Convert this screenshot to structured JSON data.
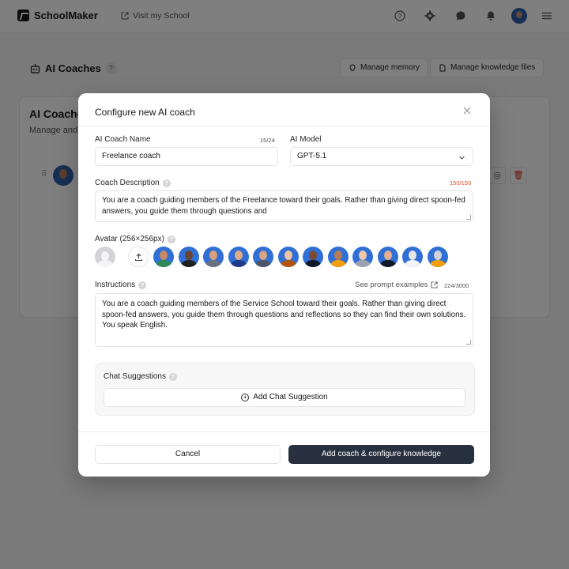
{
  "app": {
    "brand": "SchoolMaker",
    "visit_label": "Visit my School"
  },
  "page": {
    "title": "AI Coaches",
    "help": "?",
    "manage_memory": "Manage memory",
    "manage_knowledge": "Manage knowledge files",
    "card_title": "AI Coaches",
    "card_subtitle": "Manage and"
  },
  "modal": {
    "title": "Configure new AI coach",
    "close": "✕",
    "name": {
      "label": "AI Coach Name",
      "value": "Freelance coach",
      "counter": "15/24"
    },
    "model": {
      "label": "AI Model",
      "value": "GPT-5.1"
    },
    "description": {
      "label": "Coach Description",
      "counter": "150/150",
      "value": "You are a coach guiding members of the Freelance toward their goals. Rather than giving direct spoon-fed answers, you guide them through questions and"
    },
    "avatar": {
      "label": "Avatar (256×256px)",
      "options": [
        {
          "skin": "#c98b62",
          "cloth": "#2e8b57",
          "bg": "#2f6fd6"
        },
        {
          "skin": "#6b4330",
          "cloth": "#1f1f1f",
          "bg": "#2f6fd6"
        },
        {
          "skin": "#d9a07a",
          "cloth": "#6b7280",
          "bg": "#2f6fd6"
        },
        {
          "skin": "#e0ac85",
          "cloth": "#1e3a8a",
          "bg": "#2f6fd6"
        },
        {
          "skin": "#d7a584",
          "cloth": "#4b5563",
          "bg": "#2f6fd6"
        },
        {
          "skin": "#f0c3a0",
          "cloth": "#b45309",
          "bg": "#2f6fd6"
        },
        {
          "skin": "#7a4a33",
          "cloth": "#111827",
          "bg": "#2f6fd6"
        },
        {
          "skin": "#b87a55",
          "cloth": "#f59e0b",
          "bg": "#2f6fd6"
        },
        {
          "skin": "#f2c9a6",
          "cloth": "#9ca3af",
          "bg": "#2f6fd6"
        },
        {
          "skin": "#e3b08c",
          "cloth": "#111827",
          "bg": "#2f6fd6"
        },
        {
          "skin": "#e5e7eb",
          "cloth": "#f3f4f6",
          "bg": "#2f6fd6"
        },
        {
          "skin": "#d1d5db",
          "cloth": "#f59e0b",
          "bg": "#2f6fd6"
        }
      ]
    },
    "instructions": {
      "label": "Instructions",
      "see_examples": "See prompt examples",
      "counter": "224/3000",
      "value": "You are a coach guiding members of the Service School toward their goals. Rather than giving direct spoon-fed answers, you guide them through questions and reflections so they can find their own solutions. You speak English."
    },
    "suggestions": {
      "label": "Chat Suggestions",
      "add_label": "Add Chat Suggestion"
    },
    "cancel_label": "Cancel",
    "submit_label": "Add coach & configure knowledge"
  },
  "colors": {
    "primary": "#27303f",
    "counter_warning": "#dc4a2e",
    "overlay": "rgba(0,0,0,0.5)"
  }
}
